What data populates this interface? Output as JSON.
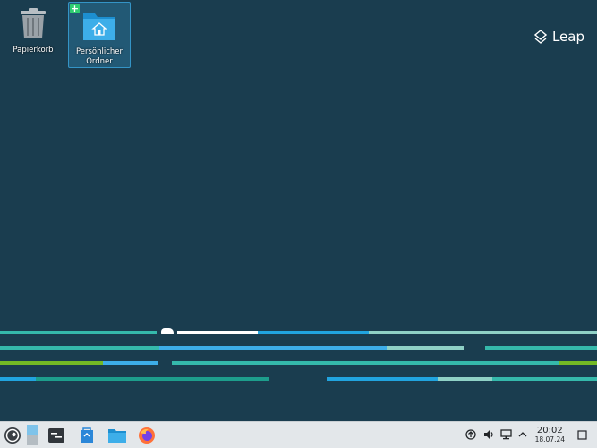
{
  "desktop": {
    "icons": [
      {
        "label": "Papierkorb",
        "icon": "trash-icon"
      },
      {
        "label": "Persönlicher Ordner",
        "icon": "home-folder-icon",
        "selected": true
      }
    ],
    "branding": {
      "logo_text": "Leap"
    }
  },
  "taskbar": {
    "launcher_icon": "opensuse-launcher-icon",
    "pager_icon": "virtual-desktop-pager-icon",
    "apps": [
      {
        "name": "konsole-icon"
      },
      {
        "name": "discover-icon"
      },
      {
        "name": "dolphin-folder-icon"
      },
      {
        "name": "firefox-icon"
      }
    ],
    "tray": [
      "update-icon",
      "volume-icon",
      "network-icon",
      "expand-tray-icon"
    ],
    "clock": {
      "time": "20:02",
      "date": "18.07.24"
    },
    "show_desktop_icon": "show-desktop-icon"
  },
  "colors": {
    "background": "#1a3d4f",
    "teal": "#35b9ab",
    "blue": "#21a4df",
    "green": "#73ba25",
    "light": "#8fd1c6",
    "taskbar": "#e3e7ea"
  }
}
